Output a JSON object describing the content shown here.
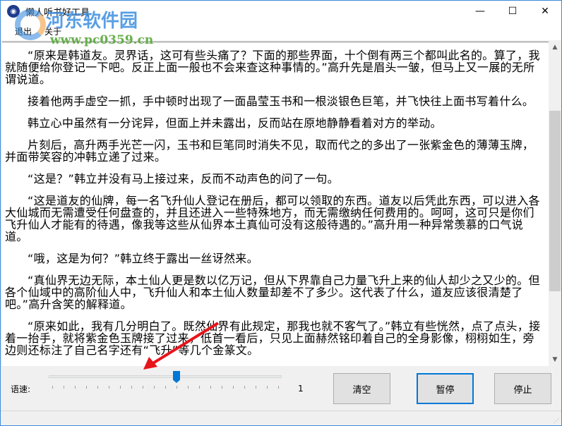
{
  "window": {
    "title": "懒人听书好工具",
    "controls": [
      "minimize",
      "maximize",
      "close"
    ]
  },
  "menu": [
    "退出",
    "关于"
  ],
  "paragraphs": [
    "“原来是韩道友。灵界话，这可有些头痛了？下面的那些界面，十个倒有两三个都叫此名的。算了，我就随便给你登记一下吧。反正上面一般也不会来查这种事情的。”高升先是眉头一皱，但马上又一展的无所谓说道。",
    "接着他两手虚空一抓，手中顿时出现了一面晶莹玉书和一根淡银色巨笔，并飞快往上面书写着什么。",
    "韩立心中虽然有一分诧异，但面上并未露出，反而站在原地静静看着对方的举动。",
    "片刻后，高升两手光芒一闪，玉书和巨笔同时消失不见，取而代之的多出了一张紫金色的薄薄玉牌，并面带笑容的冲韩立递了过来。",
    "“这是？”韩立并没有马上接过来，反而不动声色的问了一句。",
    "“这是道友的仙牌，每一名飞升仙人登记在册后，都可以领取的东西。道友以后凭此东西，可以进入各大仙城而无需遭受任何盘查的，并且还进入一些特殊地方，而无需缴纳任何费用的。呵呵，这可只是你们飞升仙人才能有的待遇，像我等这些从仙界本土真仙可没有这般待遇的。”高升用一种异常羡慕的口气说道。",
    "“哦，这是为何？”韩立终于露出一丝讶然来。",
    "“真仙界无边无际，本土仙人更是数以亿万记，但从下界靠自己力量飞升上来的仙人却少之又少的。但各个仙域中的高阶仙人中，飞升仙人和本土仙人数量却差不了多少。这代表了什么，道友应该很清楚了吧。”高升含笑的解释道。",
    "“原来如此，我有几分明白了。既然仙界有此规定，那我也就不客气了。”韩立有些恍然，点了点头，接着一抬手，就将紫金色玉牌接了过来，低首一看后，只见上面赫然铭印着自己的全身影像，栩栩如生，旁边则还标注了自己名字还有“飞升”等几个金篆文。"
  ],
  "controls": {
    "speed_label": "语速:",
    "speed_value": "1",
    "speed_min": -10,
    "speed_max": 10,
    "clear": "清空",
    "pause": "暂停",
    "stop": "停止"
  },
  "watermark": {
    "name": "河东软件园",
    "url": "www.pc0359.cn"
  },
  "accent": "#0078d7"
}
